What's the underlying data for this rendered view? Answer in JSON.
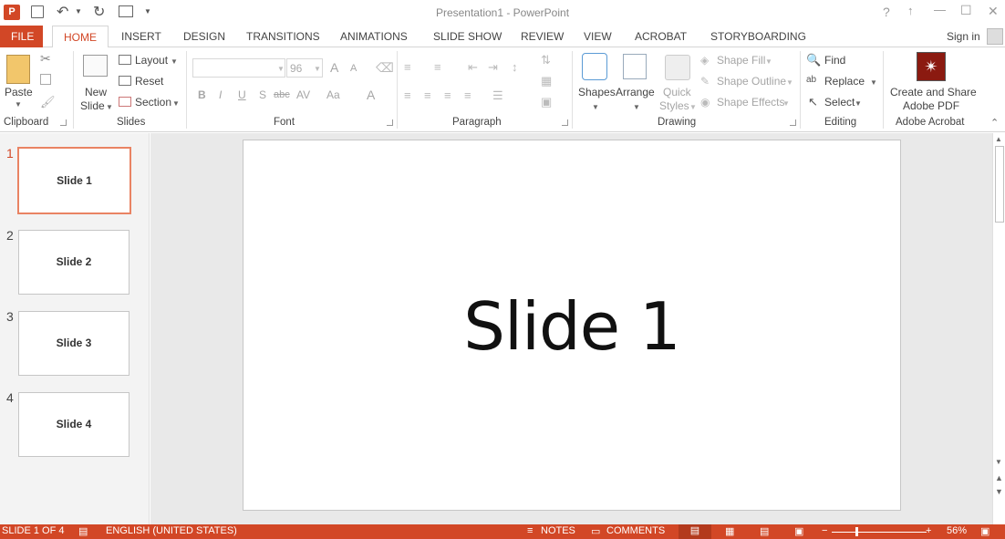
{
  "window": {
    "title": "Presentation1 - PowerPoint",
    "help_glyph": "?",
    "controls": [
      "↑",
      "—",
      "☐",
      "✕"
    ]
  },
  "tabs": [
    "FILE",
    "HOME",
    "INSERT",
    "DESIGN",
    "TRANSITIONS",
    "ANIMATIONS",
    "SLIDE SHOW",
    "REVIEW",
    "VIEW",
    "ACROBAT",
    "STORYBOARDING"
  ],
  "active_tab": "HOME",
  "sign_in": "Sign in",
  "ribbon": {
    "clipboard": {
      "group": "Clipboard",
      "paste": "Paste"
    },
    "slides": {
      "group": "Slides",
      "new_slide_1": "New",
      "new_slide_2": "Slide",
      "layout": "Layout",
      "reset": "Reset",
      "section": "Section"
    },
    "font": {
      "group": "Font",
      "font_name": "",
      "font_size": "96",
      "bold": "B",
      "italic": "I",
      "underline": "U",
      "shadow": "S",
      "strike": "abc",
      "spacing": "AV",
      "case": "Aa",
      "color": "A",
      "grow": "A",
      "shrink": "A"
    },
    "paragraph": {
      "group": "Paragraph"
    },
    "drawing": {
      "group": "Drawing",
      "shapes": "Shapes",
      "arrange": "Arrange",
      "quick_styles_1": "Quick",
      "quick_styles_2": "Styles",
      "shape_fill": "Shape Fill",
      "shape_outline": "Shape Outline",
      "shape_effects": "Shape Effects"
    },
    "editing": {
      "group": "Editing",
      "find": "Find",
      "replace": "Replace",
      "select": "Select"
    },
    "acrobat": {
      "group": "Adobe Acrobat",
      "create_1": "Create and Share",
      "create_2": "Adobe PDF"
    }
  },
  "slides": [
    {
      "number": "1",
      "title": "Slide 1"
    },
    {
      "number": "2",
      "title": "Slide 2"
    },
    {
      "number": "3",
      "title": "Slide 3"
    },
    {
      "number": "4",
      "title": "Slide 4"
    }
  ],
  "current_slide": {
    "title": "Slide 1"
  },
  "status": {
    "slide_info": "SLIDE 1 OF 4",
    "language": "ENGLISH (UNITED STATES)",
    "notes": "NOTES",
    "comments": "COMMENTS",
    "zoom": "56%",
    "zoom_level": 0.56
  },
  "colors": {
    "accent": "#d24726",
    "selection": "#e98363"
  }
}
